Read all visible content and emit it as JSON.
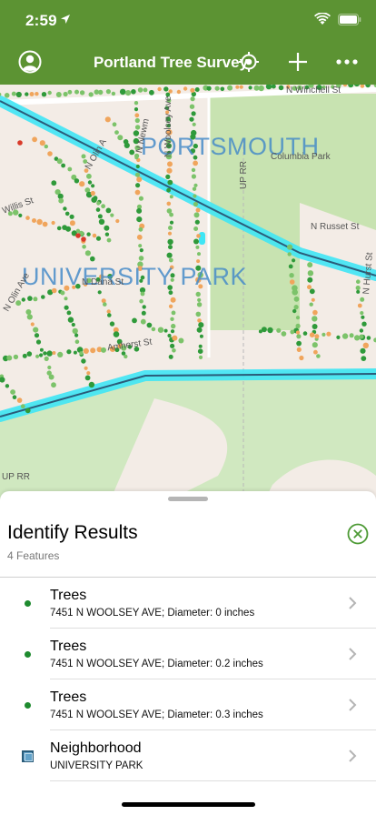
{
  "status_bar": {
    "time": "2:59"
  },
  "navbar": {
    "title": "Portland Tree Survey",
    "icons": [
      "account-icon",
      "locate-icon",
      "add-icon",
      "more-icon"
    ]
  },
  "map": {
    "neighborhood_labels": [
      "PORTSMOUTH",
      "UNIVERSITY PARK"
    ],
    "streets": [
      "N Winchell St",
      "Columbia Park",
      "N Russet St",
      "N Woolsey Ave",
      "UP RR",
      "Amherst St",
      "N Olin A",
      "UP RR",
      "N Newm",
      "N Dana St",
      "N Olin Ave",
      "Willis St",
      "N Hurst St"
    ],
    "colors": {
      "tree_healthy": "#2f9a3a",
      "tree_light": "#7cc36a",
      "tree_orange": "#f0a55c",
      "tree_red": "#d93a2a",
      "park": "#c8e3b1",
      "highlight": "#3fe6f5"
    }
  },
  "sheet": {
    "title": "Identify Results",
    "subtitle": "4 Features",
    "results": [
      {
        "title": "Trees",
        "detail": "7451 N WOOLSEY AVE; Diameter: 0 inches",
        "symbol": "tree-point"
      },
      {
        "title": "Trees",
        "detail": "7451 N WOOLSEY AVE; Diameter: 0.2 inches",
        "symbol": "tree-point"
      },
      {
        "title": "Trees",
        "detail": "7451 N WOOLSEY AVE; Diameter: 0.3 inches",
        "symbol": "tree-point"
      },
      {
        "title": "Neighborhood",
        "detail": "UNIVERSITY PARK",
        "symbol": "polygon"
      }
    ]
  }
}
